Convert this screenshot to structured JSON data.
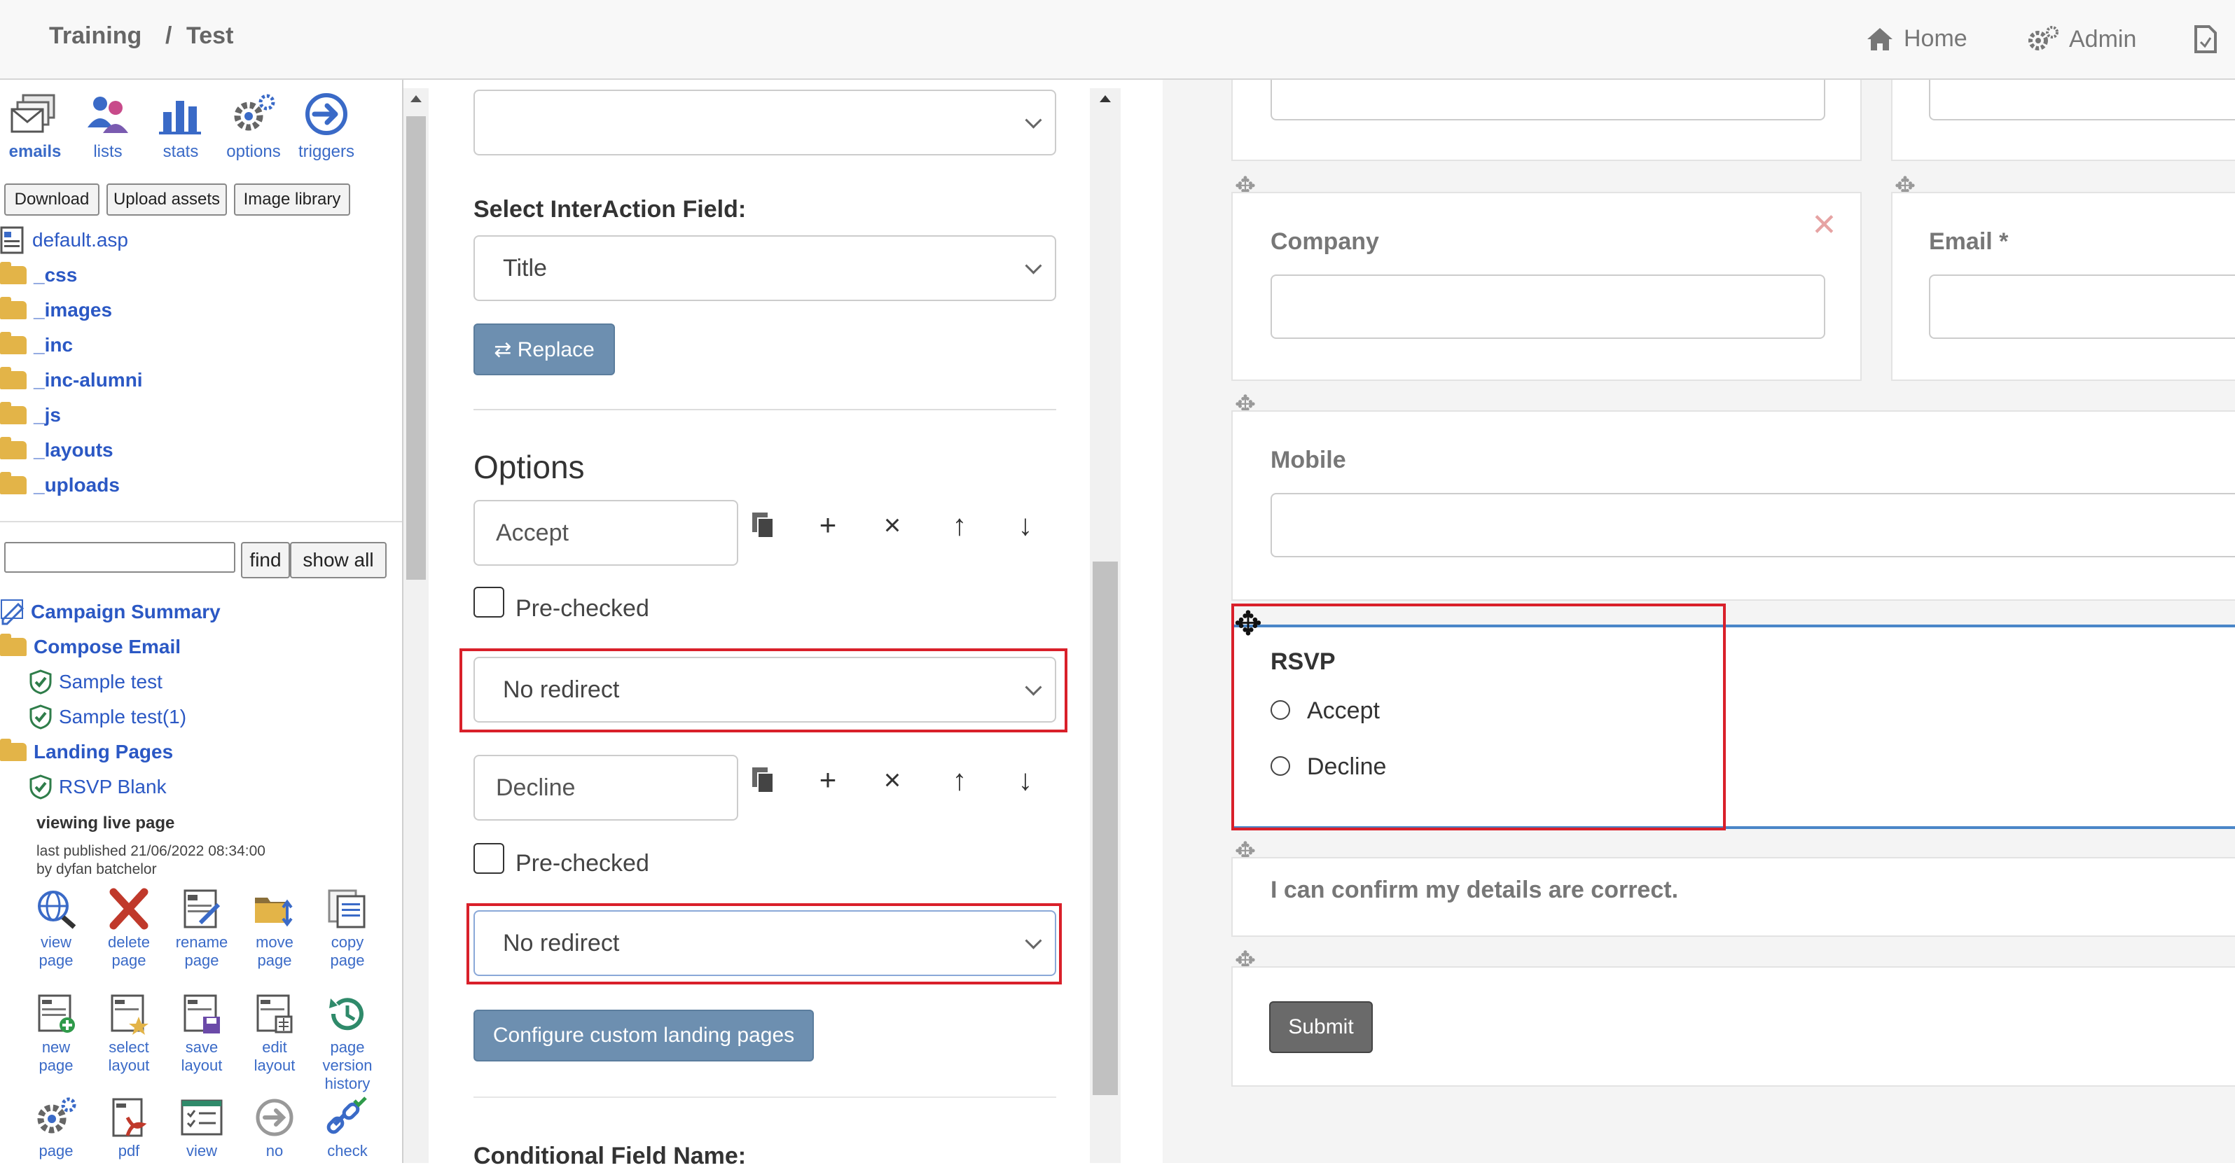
{
  "breadcrumb": {
    "part1": "Training",
    "sep": "/",
    "part2": "Test"
  },
  "topnav": {
    "home": "Home",
    "admin": "Admin"
  },
  "toolbar": {
    "emails": "emails",
    "lists": "lists",
    "stats": "stats",
    "options": "options",
    "triggers": "triggers"
  },
  "asset_buttons": {
    "download": "Download",
    "upload": "Upload assets",
    "library": "Image library"
  },
  "files": [
    "default.asp",
    "_css",
    "_images",
    "_inc",
    "_inc-alumni",
    "_js",
    "_layouts",
    "_uploads"
  ],
  "search": {
    "value": "",
    "find": "find",
    "show_all": "show all"
  },
  "tree": {
    "campaign_summary": "Campaign Summary",
    "compose_email": "Compose Email",
    "sample_test": "Sample test",
    "sample_test1": "Sample test(1)",
    "landing_pages": "Landing Pages",
    "rsvp_blank": "RSVP Blank"
  },
  "page_info": {
    "viewing": "viewing  live  page",
    "published": "last published 21/06/2022 08:34:00",
    "by": "by dyfan batchelor"
  },
  "actions": {
    "row1": [
      [
        "view",
        "page"
      ],
      [
        "delete",
        "page"
      ],
      [
        "rename",
        "page"
      ],
      [
        "move",
        "page"
      ],
      [
        "copy",
        "page"
      ]
    ],
    "row2": [
      [
        "new",
        "page"
      ],
      [
        "select",
        "layout"
      ],
      [
        "save",
        "layout"
      ],
      [
        "edit",
        "layout"
      ],
      [
        "page",
        "version",
        "history"
      ]
    ],
    "row3": [
      [
        "page"
      ],
      [
        "pdf"
      ],
      [
        "view"
      ],
      [
        "no"
      ],
      [
        "check"
      ]
    ]
  },
  "editor": {
    "top_select": "",
    "interaction_label": "Select InterAction Field:",
    "interaction_value": "Title",
    "replace": "⇄ Replace",
    "options_heading": "Options",
    "option1": "Accept",
    "option2": "Decline",
    "prechecked": "Pre-checked",
    "redirect1": "No redirect",
    "redirect2": "No redirect",
    "configure": "Configure custom landing pages",
    "conditional": "Conditional Field Name:"
  },
  "form": {
    "company": "Company",
    "email": "Email *",
    "mobile": "Mobile",
    "rsvp": "RSVP",
    "accept": "Accept",
    "decline": "Decline",
    "confirm": "I can confirm my details are correct.",
    "submit": "Submit"
  },
  "colors": {
    "accent_red": "#d9202a",
    "link_blue": "#2b58c4",
    "button_blue": "#6d8fb0",
    "submit_gray": "#6a6a6a"
  }
}
